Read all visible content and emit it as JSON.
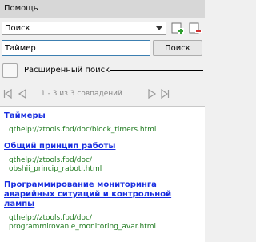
{
  "panel": {
    "title": "Помощь"
  },
  "mode_select": {
    "selected": "Поиск"
  },
  "icons": {
    "add": "add-page-icon",
    "remove": "remove-page-icon",
    "add_color": "#2e9e2e",
    "remove_color": "#d03030"
  },
  "search": {
    "value": "Таймер",
    "button_label": "Поиск"
  },
  "advanced": {
    "toggle_label": "+",
    "label": "Расширенный поиск"
  },
  "navigation": {
    "match_count": "1 - 3 из 3 совпадений",
    "first": "first-page-icon",
    "prev": "previous-page-icon",
    "next": "next-page-icon",
    "last": "last-page-icon"
  },
  "results": [
    {
      "title_lines": [
        "Таймеры"
      ],
      "url_lines": [
        "qthelp://ztools.fbd/doc/block_timers.html"
      ]
    },
    {
      "title_lines": [
        "Общий принцип работы"
      ],
      "url_lines": [
        "qthelp://ztools.fbd/doc/",
        "obshii_princip_raboti.html"
      ]
    },
    {
      "title_lines": [
        "Программирование мониторинга",
        "аварийных ситуаций и контрольной",
        "лампы"
      ],
      "url_lines": [
        "qthelp://ztools.fbd/doc/",
        "programmirovanie_monitoring_avar.html"
      ]
    }
  ],
  "colors": {
    "link": "#1a2fe0",
    "url": "#1f7a1f",
    "input_focus_border": "#3c7fb1"
  }
}
